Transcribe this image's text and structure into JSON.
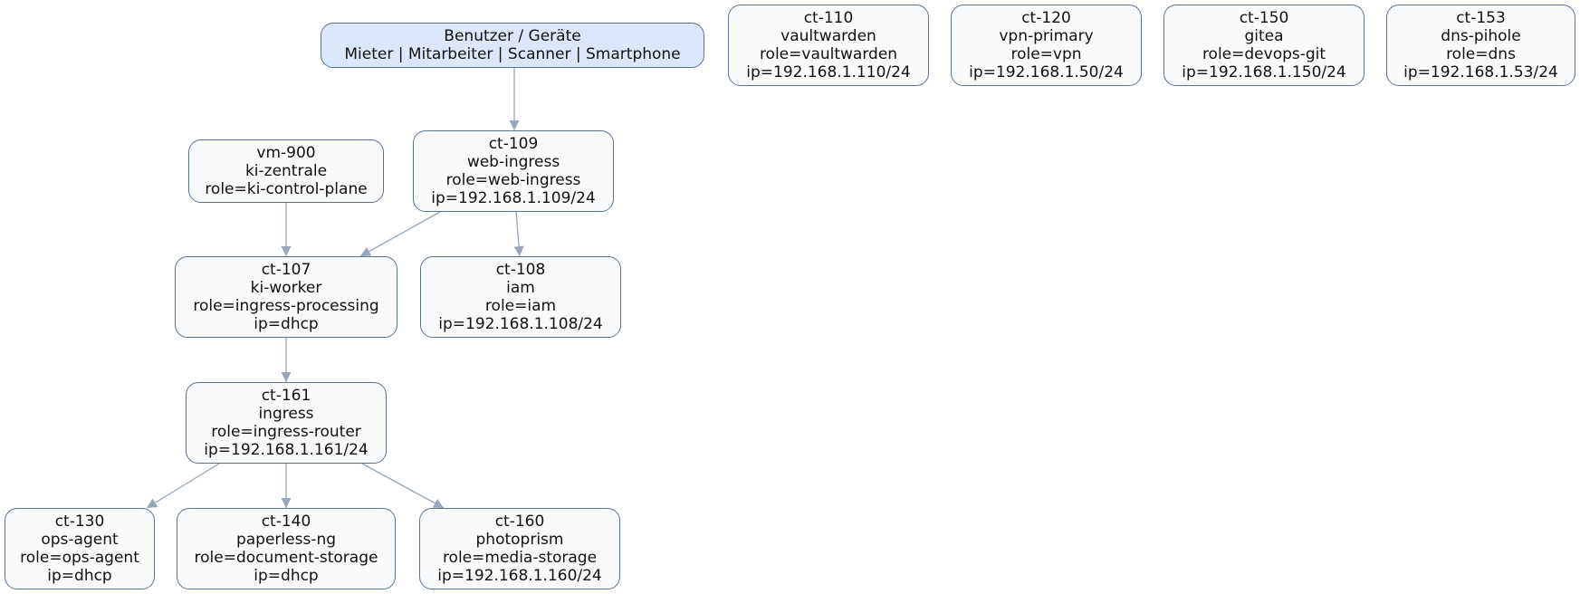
{
  "diagram": {
    "nodes": [
      {
        "id": "users",
        "lines": [
          "Benutzer / Geräte",
          "Mieter | Mitarbeiter | Scanner | Smartphone"
        ],
        "style": "user"
      },
      {
        "id": "ct-110",
        "lines": [
          "ct-110",
          "vaultwarden",
          "role=vaultwarden",
          "ip=192.168.1.110/24"
        ]
      },
      {
        "id": "ct-120",
        "lines": [
          "ct-120",
          "vpn-primary",
          "role=vpn",
          "ip=192.168.1.50/24"
        ]
      },
      {
        "id": "ct-150",
        "lines": [
          "ct-150",
          "gitea",
          "role=devops-git",
          "ip=192.168.1.150/24"
        ]
      },
      {
        "id": "ct-153",
        "lines": [
          "ct-153",
          "dns-pihole",
          "role=dns",
          "ip=192.168.1.53/24"
        ]
      },
      {
        "id": "vm-900",
        "lines": [
          "vm-900",
          "ki-zentrale",
          "role=ki-control-plane"
        ]
      },
      {
        "id": "ct-109",
        "lines": [
          "ct-109",
          "web-ingress",
          "role=web-ingress",
          "ip=192.168.1.109/24"
        ]
      },
      {
        "id": "ct-107",
        "lines": [
          "ct-107",
          "ki-worker",
          "role=ingress-processing",
          "ip=dhcp"
        ]
      },
      {
        "id": "ct-108",
        "lines": [
          "ct-108",
          "iam",
          "role=iam",
          "ip=192.168.1.108/24"
        ]
      },
      {
        "id": "ct-161",
        "lines": [
          "ct-161",
          "ingress",
          "role=ingress-router",
          "ip=192.168.1.161/24"
        ]
      },
      {
        "id": "ct-130",
        "lines": [
          "ct-130",
          "ops-agent",
          "role=ops-agent",
          "ip=dhcp"
        ]
      },
      {
        "id": "ct-140",
        "lines": [
          "ct-140",
          "paperless-ng",
          "role=document-storage",
          "ip=dhcp"
        ]
      },
      {
        "id": "ct-160",
        "lines": [
          "ct-160",
          "photoprism",
          "role=media-storage",
          "ip=192.168.1.160/24"
        ]
      }
    ],
    "edges": [
      {
        "from": "users",
        "to": "ct-109"
      },
      {
        "from": "vm-900",
        "to": "ct-107"
      },
      {
        "from": "ct-109",
        "to": "ct-107"
      },
      {
        "from": "ct-109",
        "to": "ct-108"
      },
      {
        "from": "ct-107",
        "to": "ct-161"
      },
      {
        "from": "ct-161",
        "to": "ct-130"
      },
      {
        "from": "ct-161",
        "to": "ct-140"
      },
      {
        "from": "ct-161",
        "to": "ct-160"
      }
    ],
    "colors": {
      "node_fill": "#f8fafc",
      "user_fill": "#dbe8fc",
      "node_border": "#5f7391",
      "edge": "#97a6bc"
    }
  }
}
